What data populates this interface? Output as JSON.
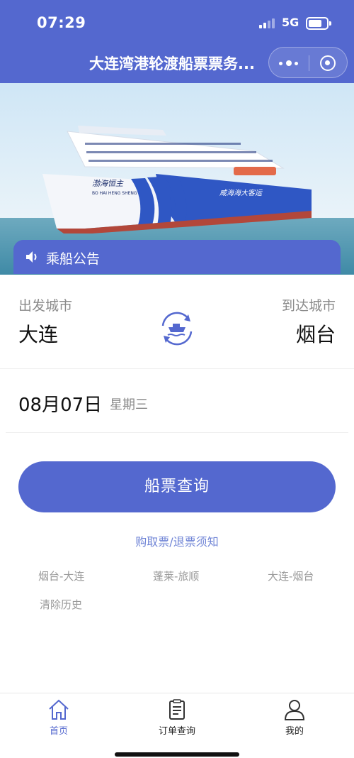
{
  "status_bar": {
    "time": "07:29",
    "network": "5G",
    "battery_level": 0.75
  },
  "nav": {
    "title": "大连湾港轮渡船票票务..."
  },
  "banner": {
    "ship_name": "渤海恒主",
    "ship_pinyin": "BO HAI HENG SHENG",
    "hull_text": "威海海大客运"
  },
  "notice": {
    "label": "乘船公告"
  },
  "route": {
    "from_label": "出发城市",
    "from_city": "大连",
    "to_label": "到达城市",
    "to_city": "烟台"
  },
  "date": {
    "value": "08月07日",
    "weekday": "星期三"
  },
  "search_button": "船票查询",
  "ticket_notice_link": "购取票/退票须知",
  "history": {
    "items": [
      "烟台-大连",
      "蓬莱-旅顺",
      "大连-烟台"
    ],
    "clear_label": "清除历史"
  },
  "tabbar": {
    "items": [
      {
        "label": "首页",
        "icon": "home-icon",
        "active": true
      },
      {
        "label": "订单查询",
        "icon": "order-icon",
        "active": false
      },
      {
        "label": "我的",
        "icon": "user-icon",
        "active": false
      }
    ]
  },
  "colors": {
    "primary": "#5468cf",
    "link": "#6f84d6",
    "muted": "#8a8a8a"
  }
}
